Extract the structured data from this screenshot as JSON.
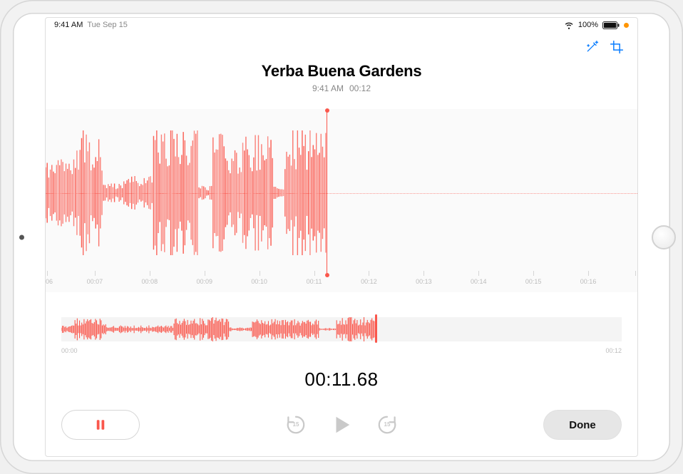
{
  "status": {
    "time": "9:41 AM",
    "date": "Tue Sep 15",
    "battery_percent": "100%"
  },
  "toolbar": {
    "enhance_icon": "enhance-sparkles",
    "crop_icon": "crop"
  },
  "recording": {
    "title": "Yerba Buena Gardens",
    "time": "9:41 AM",
    "duration": "00:12",
    "elapsed": "00:11.68"
  },
  "waveform": {
    "playhead_fraction": 0.475,
    "axis_ticks": [
      "06",
      "00:07",
      "00:08",
      "00:09",
      "00:10",
      "00:11",
      "00:12",
      "00:13",
      "00:14",
      "00:15",
      "00:16",
      ""
    ]
  },
  "overview": {
    "start_label": "00:00",
    "end_label": "00:12",
    "progress_fraction": 0.56
  },
  "controls": {
    "pause_label": "Pause",
    "skip_back_seconds": "15",
    "play_label": "Play",
    "skip_forward_seconds": "15",
    "done_label": "Done"
  },
  "colors": {
    "accent_red": "#fa574c",
    "accent_blue": "#0a7dff",
    "muted": "#c9c9c9",
    "recording_indicator": "#ff9500"
  }
}
